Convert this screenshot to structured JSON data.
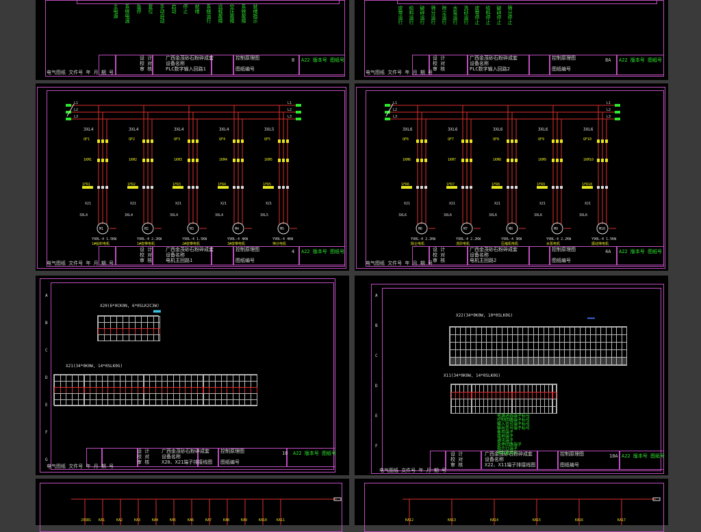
{
  "colors": {
    "frame": "#c04ec0",
    "background": "#000000",
    "wire": "#e03030",
    "text": "#e0e0e0",
    "yellow": "#e8e820",
    "green": "#2ee82e",
    "cyan": "#3cc8e8"
  },
  "top_left": {
    "vertical_labels": [
      "主电源",
      "系统电源",
      "急停",
      "复位",
      "手动自动",
      "启动",
      "停止",
      "就绪",
      "系统运行",
      "远程故障",
      "空压故障",
      "系统故障",
      "就绪指示"
    ],
    "title_block": {
      "r1c1": "设 计",
      "r2c1": "校 对",
      "r3c1": "审 核",
      "project": "广西金茂砂石粉碎成套",
      "type": "设备名称",
      "name": "PLC数字输入回路1",
      "drawing": "控制原理图",
      "no": "图纸编号",
      "sheet": "8",
      "ver": "A22 版本号 图纸号"
    },
    "footer": "电气图纸 文件号  年 月  期  号"
  },
  "top_right": {
    "vertical_labels": [
      "皮带运行",
      "给料运行",
      "破碎运行",
      "筛分运行",
      "除尘运行",
      "水泵运行",
      "洗砂运行",
      "皮带停止",
      "给料停止",
      "破碎停止",
      "筛分停止"
    ],
    "title_block": {
      "r1c1": "设 计",
      "r2c1": "校 对",
      "r3c1": "审 核",
      "project": "广西金茂砂石粉碎成套",
      "type": "设备名称",
      "name": "PLC数字输入回路2",
      "drawing": "控制原理图",
      "no": "图纸编号",
      "sheet": "8A",
      "ver": "A22 版本号 图纸号"
    },
    "footer": "电气图纸 文件号  年 月  期  号"
  },
  "mid_left": {
    "bus_labels": [
      "L1",
      "L2",
      "L3"
    ],
    "branches": [
      {
        "xl": "3XL4",
        "qf": "QF1",
        "km": "1KM1",
        "fr": "1FR1",
        "x": "X21",
        "motor": "M1",
        "spec": "Y90L-4 1.5KW",
        "name": "1#给料电机"
      },
      {
        "xl": "3XL4",
        "qf": "QF2",
        "km": "1KM2",
        "fr": "1FR2",
        "x": "X21",
        "motor": "M2",
        "spec": "Y90L-4 2.2KW",
        "name": "1#皮带电机"
      },
      {
        "xl": "3XL4",
        "qf": "QF3",
        "km": "1KM3",
        "fr": "1FR3",
        "x": "X21",
        "motor": "M3",
        "spec": "Y90L-4 1.5KW",
        "name": "2#皮带电机"
      },
      {
        "xl": "3XL4",
        "qf": "QF4",
        "km": "1KM4",
        "fr": "1FR4",
        "x": "X21",
        "motor": "M4",
        "spec": "Y90L-4 4KW",
        "name": "3#皮带电机"
      },
      {
        "xl": "3XL5",
        "qf": "QF5",
        "km": "1KM5",
        "fr": "1FR5",
        "x": "X21",
        "motor": "M5",
        "spec": "Y90L-4 4KW",
        "name": "筛分电机"
      }
    ],
    "title_block": {
      "r1c1": "设 计",
      "r2c1": "校 对",
      "r3c1": "审 核",
      "project": "广西金茂砂石粉碎成套",
      "type": "设备名称",
      "name": "电机主回路1",
      "drawing": "控制原理图",
      "no": "图纸编号",
      "sheet": "4",
      "ver": "A22 版本号 图纸号"
    },
    "footer": "电气图纸 文件号  年 月  期  号"
  },
  "mid_right": {
    "bus_labels": [
      "L1",
      "L2",
      "L3"
    ],
    "branches": [
      {
        "xl": "3XL6",
        "qf": "QF6",
        "km": "1KM6",
        "fr": "1FR6",
        "x": "X21",
        "motor": "M6",
        "spec": "Y90L-4 2.2KW",
        "name": "除尘电机"
      },
      {
        "xl": "3XL6",
        "qf": "QF7",
        "km": "1KM7",
        "fr": "1FR7",
        "x": "X21",
        "motor": "M7",
        "spec": "Y90L-4 2.2KW",
        "name": "洗砂电机"
      },
      {
        "xl": "3XL6",
        "qf": "QF8",
        "km": "1KM8",
        "fr": "1FR8",
        "x": "X21",
        "motor": "M8",
        "spec": "Y90L-4 3KW",
        "name": "压缩机电机"
      },
      {
        "xl": "3XL6",
        "qf": "QF9",
        "km": "1KM9",
        "fr": "1FR9",
        "x": "X21",
        "motor": "M9",
        "spec": "Y90L-4 2.2KW",
        "name": "水泵电机"
      },
      {
        "xl": "3XL6",
        "qf": "QF10",
        "km": "1KM10",
        "fr": "1FR10",
        "x": "X21",
        "motor": "M10",
        "spec": "Y90L-4 1.5KW",
        "name": "振动筛电机"
      }
    ],
    "title_block": {
      "r1c1": "设 计",
      "r2c1": "校 对",
      "r3c1": "审 核",
      "project": "广西金茂砂石粉碎成套",
      "type": "设备名称",
      "name": "电机主回路2",
      "drawing": "控制原理图",
      "no": "图纸编号",
      "sheet": "4A",
      "ver": "A22 版本号 图纸号"
    },
    "footer": "电气图纸 文件号  年 月  期  号"
  },
  "low_left": {
    "block1_title": "X20(6*0CK0N, 6*0SLK2C3W)",
    "block2_title": "X21(34*0K0W, 14*0SLK0G)",
    "row_letters": [
      "A",
      "B",
      "C",
      "D",
      "E",
      "F",
      "G"
    ],
    "title_block": {
      "r1c1": "设 计",
      "r2c1": "校 对",
      "r3c1": "审 核",
      "project": "广西金茂砂石粉碎成套",
      "type": "设备名称",
      "name": "X20、X21端子排接线图",
      "drawing": "控制原理图",
      "no": "图纸编号",
      "sheet": "10",
      "ver": "A22 版本号 图纸号"
    },
    "footer": "电气图纸 文件号  年 月  期  号"
  },
  "low_right": {
    "block1_title": "X22(34*0K0W, 10*0SLK0G)",
    "block2_title": "X11(34*0K0W, 14*0SLK0G)",
    "row_letters": [
      "A",
      "B",
      "C",
      "D",
      "E",
      "F"
    ],
    "notes": [
      "电源进线端子标号",
      "控制回路端子标号",
      "输入信号端子标号",
      "输出信号端子标号",
      "备用端子",
      "接地端子",
      "通讯端子",
      "急停回路端子",
      "指示灯端子",
      "模拟量端子"
    ],
    "title_block": {
      "r1c1": "设 计",
      "r2c1": "校 对",
      "r3c1": "审 核",
      "project": "广西金茂砂石粉碎成套",
      "type": "设备名称",
      "name": "X22、X11端子排接线图",
      "drawing": "控制原理图",
      "no": "图纸编号",
      "sheet": "10A",
      "ver": "A22 版本号 图纸号"
    },
    "footer": "电气图纸 文件号  年 月  期  号"
  },
  "bottom_left": {
    "labels": [
      "JXSB1",
      "KA1",
      "KA2",
      "KA3",
      "KA4",
      "KA5",
      "KA6",
      "KA7",
      "KA8",
      "KA9",
      "KA10",
      "KA11"
    ]
  },
  "bottom_right": {
    "labels": [
      "KA12",
      "KA13",
      "KA14",
      "KA15",
      "KA16",
      "KA17"
    ]
  }
}
